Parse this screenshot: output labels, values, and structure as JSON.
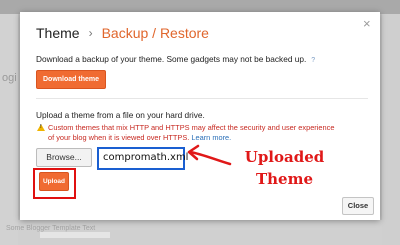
{
  "background": {
    "faint_text": "ogi",
    "faint_footer": "Some Blogger Template Text"
  },
  "dialog": {
    "title": "Theme",
    "separator": "›",
    "current_section": "Backup / Restore",
    "close_icon": "×",
    "download_description": "Download a backup of your theme. Some gadgets may not be backed up.",
    "help_icon": "?",
    "download_button": "Download theme",
    "upload_description": "Upload a theme from a file on your hard drive.",
    "warning_text": "Custom themes that mix HTTP and HTTPS may affect the security and user experience of your blog when it is viewed over HTTPS.",
    "learn_more": "Learn more.",
    "browse_button": "Browse...",
    "selected_file": "compromath.xml",
    "upload_button": "Upload",
    "close_button": "Close"
  },
  "annotation": {
    "line1": "Uploaded",
    "line2": "Theme"
  },
  "colors": {
    "accent": "#f06b32",
    "annotation_red": "#e01818",
    "file_box_blue": "#1a5fd1",
    "link_blue": "#2a6fb7"
  }
}
